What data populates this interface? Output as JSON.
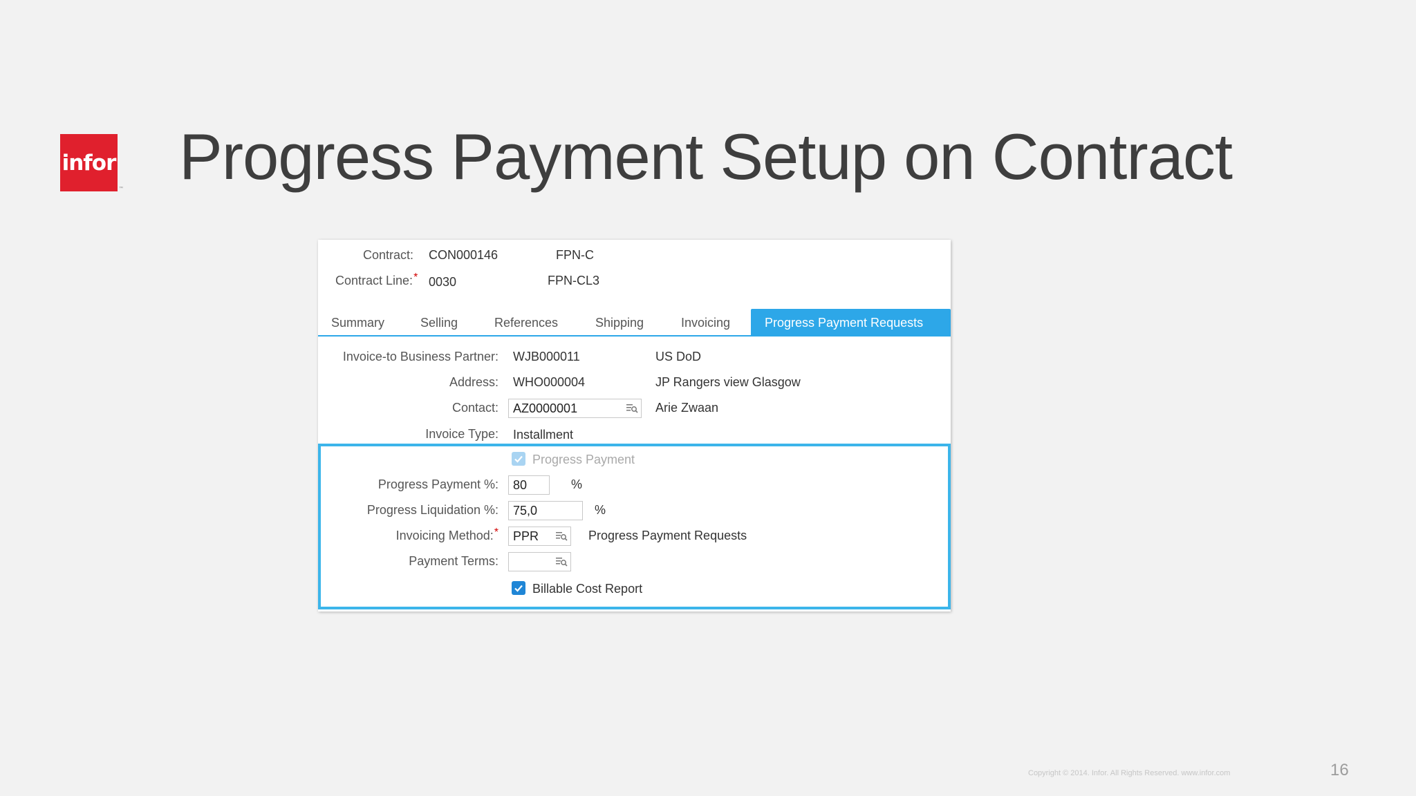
{
  "slide": {
    "logo_text": "infor",
    "logo_tm": "™",
    "title": "Progress Payment Setup on Contract",
    "copyright": "Copyright © 2014. Infor. All Rights Reserved. www.infor.com",
    "page_number": "16"
  },
  "header": {
    "contract_label": "Contract:",
    "contract_value": "CON000146",
    "contract_desc": "FPN-C",
    "contract_line_label": "Contract Line:",
    "contract_line_required": "*",
    "contract_line_value": "0030",
    "contract_line_desc": "FPN-CL3"
  },
  "tabs": [
    {
      "label": "Summary"
    },
    {
      "label": "Selling"
    },
    {
      "label": "References"
    },
    {
      "label": "Shipping"
    },
    {
      "label": "Invoicing"
    },
    {
      "label": "Progress Payment Requests",
      "active": true
    }
  ],
  "form": {
    "bp_label": "Invoice-to Business Partner:",
    "bp_value": "WJB000011",
    "bp_desc": "US DoD",
    "address_label": "Address:",
    "address_value": "WHO000004",
    "address_desc": "JP Rangers view Glasgow",
    "contact_label": "Contact:",
    "contact_value": "AZ0000001",
    "contact_desc": "Arie Zwaan",
    "invoice_type_label": "Invoice Type:",
    "invoice_type_value": "Installment"
  },
  "progress": {
    "progress_payment_checkbox_label": "Progress Payment",
    "progress_payment_checked": true,
    "pp_percent_label": "Progress Payment %:",
    "pp_percent_value": "80",
    "pp_percent_unit": "%",
    "liq_percent_label": "Progress Liquidation %:",
    "liq_percent_value": "75,0",
    "liq_percent_unit": "%",
    "method_label": "Invoicing Method:",
    "method_required": "*",
    "method_value": "PPR",
    "method_desc": "Progress Payment Requests",
    "terms_label": "Payment Terms:",
    "terms_value": "",
    "billable_label": "Billable Cost Report",
    "billable_checked": true
  },
  "colors": {
    "accent": "#2da7e8",
    "highlight_border": "#3cb5ea",
    "logo_red": "#e0202d",
    "required": "#d20000"
  }
}
